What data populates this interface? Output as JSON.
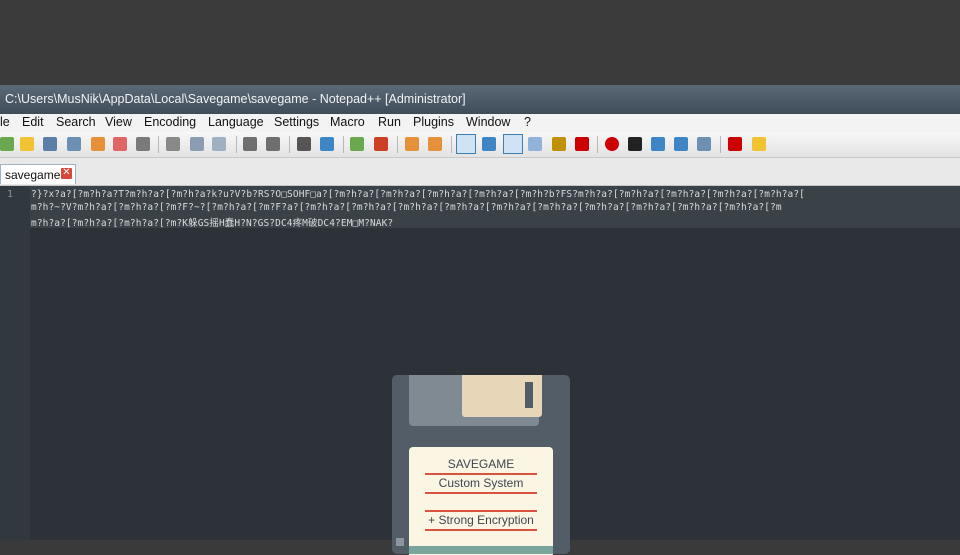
{
  "window": {
    "title": "C:\\Users\\MusNik\\AppData\\Local\\Savegame\\savegame - Notepad++ [Administrator]"
  },
  "menu": {
    "items": [
      "le",
      "Edit",
      "Search",
      "View",
      "Encoding",
      "Language",
      "Settings",
      "Macro",
      "Run",
      "Plugins",
      "Window",
      "?"
    ]
  },
  "tabs": [
    {
      "label": "savegame",
      "close": "✕"
    }
  ],
  "editor": {
    "line_number": "1",
    "lines": [
      "?}?x?a?[?m?h?a?T?m?h?a?[?m?h?a?k?u?V?b?RS?O□SOHF□a?[?m?h?a?[?m?h?a?[?m?h?a?[?m?h?a?[?m?h?b?FS?m?h?a?[?m?h?a?[?m?h?a?[?m?h?a?[?m?h?a?[",
      "m?h?~?V?m?h?a?[?m?h?a?[?m?F?~?[?m?h?a?[?m?F?a?[?m?h?a?[?m?h?a?[?m?h?a?[?m?h?a?[?m?h?a?[?m?h?a?[?m?h?a?[?m?h?a?[?m?h?a?[?m?h?a?[?m",
      "m?h?a?[?m?h?a?[?m?h?a?[?m?K躲GS摇H蠢H?N?GS?DC4疼M破DC4?EM□M?NAK?"
    ]
  },
  "floppy_label": {
    "line1": "SAVEGAME",
    "line2": "Custom System",
    "line3": "+ Strong Encryption"
  },
  "colors": {
    "editor_bg": "#2c3237",
    "accent_red": "#d9533e",
    "floppy_body": "#535d67"
  }
}
